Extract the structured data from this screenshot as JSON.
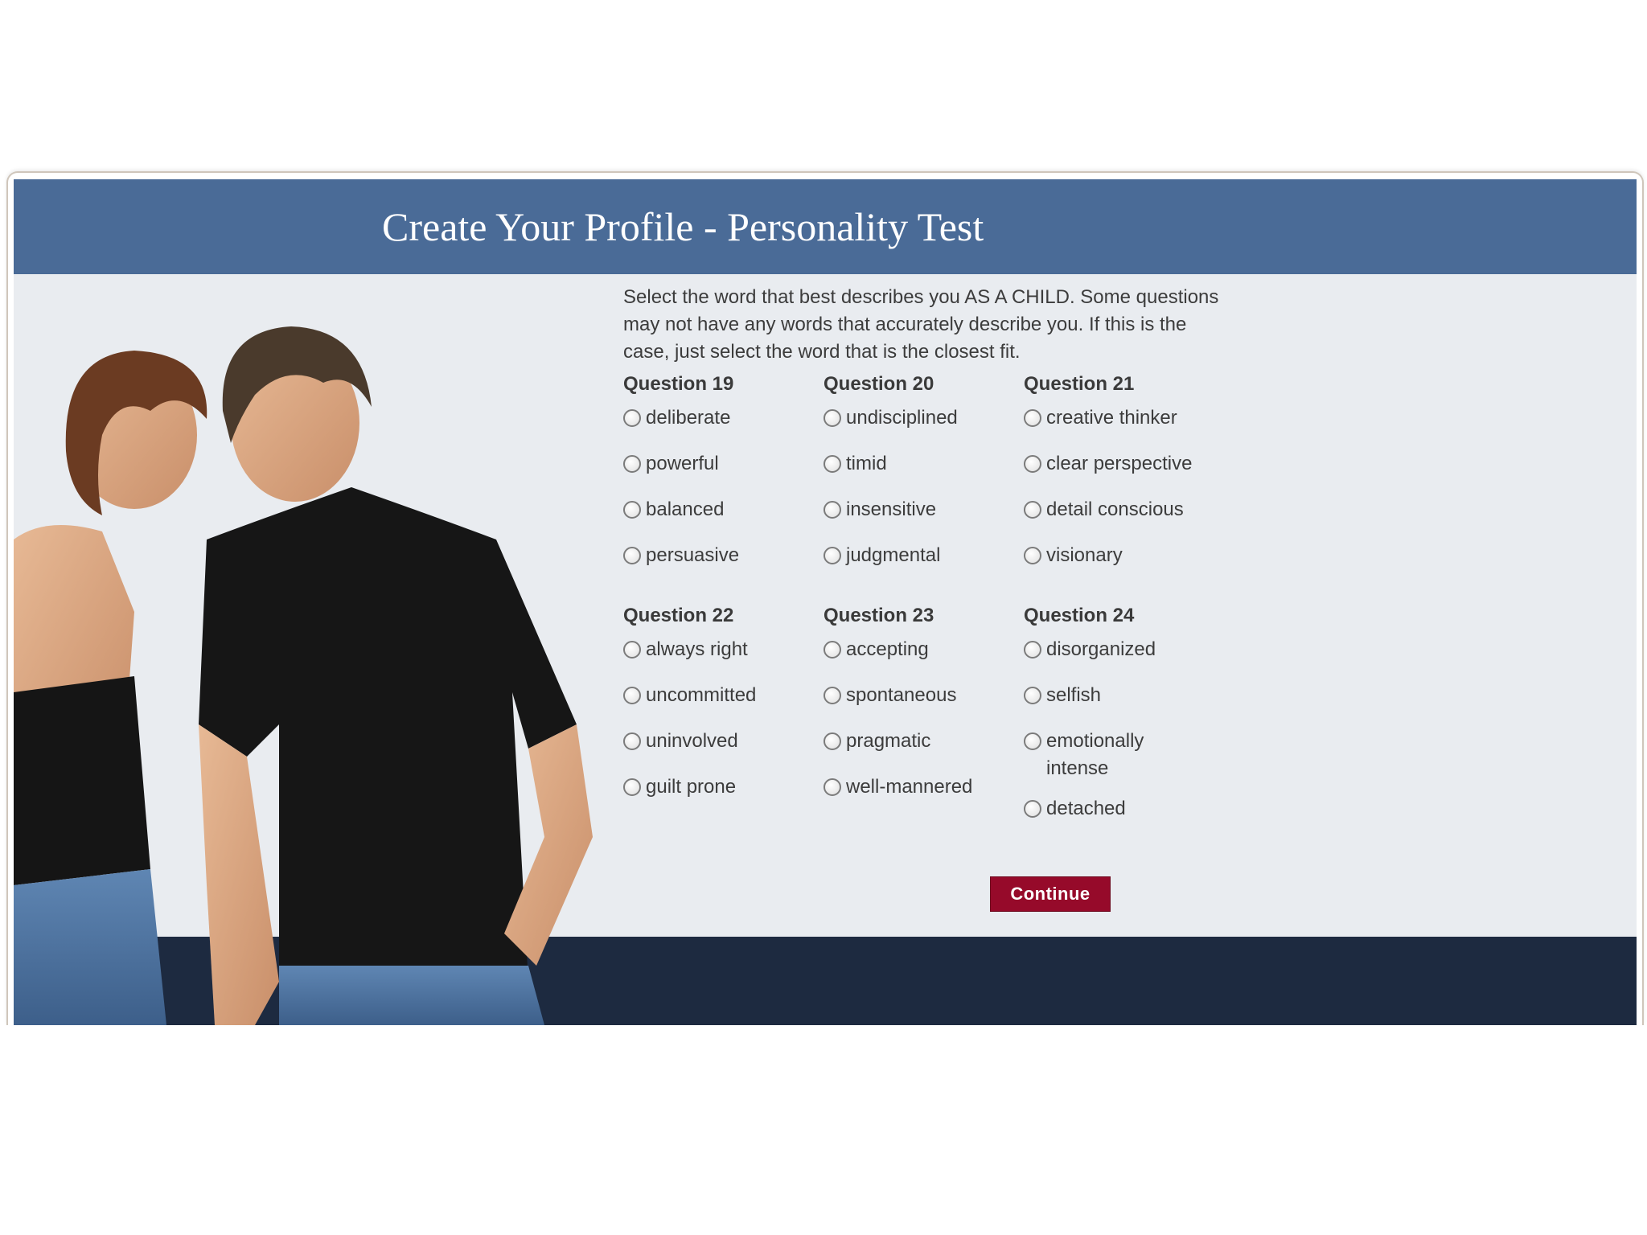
{
  "header": {
    "title": "Create Your Profile - Personality Test"
  },
  "instructions": "Select the word that best describes you AS A CHILD. Some questions may not have any words that accurately describe you. If this is the case, just select the word that is the closest fit.",
  "questions": [
    {
      "label": "Question 19",
      "options": [
        "deliberate",
        "powerful",
        "balanced",
        "persuasive"
      ]
    },
    {
      "label": "Question 20",
      "options": [
        "undisciplined",
        "timid",
        "insensitive",
        "judgmental"
      ]
    },
    {
      "label": "Question 21",
      "options": [
        "creative thinker",
        "clear perspective",
        "detail conscious",
        "visionary"
      ]
    },
    {
      "label": "Question 22",
      "options": [
        "always right",
        "uncommitted",
        "uninvolved",
        "guilt prone"
      ]
    },
    {
      "label": "Question 23",
      "options": [
        "accepting",
        "spontaneous",
        "pragmatic",
        "well-mannered"
      ]
    },
    {
      "label": "Question 24",
      "options": [
        "disorganized",
        "selfish",
        "emotionally intense",
        "detached"
      ]
    }
  ],
  "continue_label": "Continue",
  "colors": {
    "header": "#4a6b97",
    "panel": "#e9ecf0",
    "footer_band": "#1d2a40",
    "button": "#960a2a",
    "text": "#3c3c3c"
  }
}
